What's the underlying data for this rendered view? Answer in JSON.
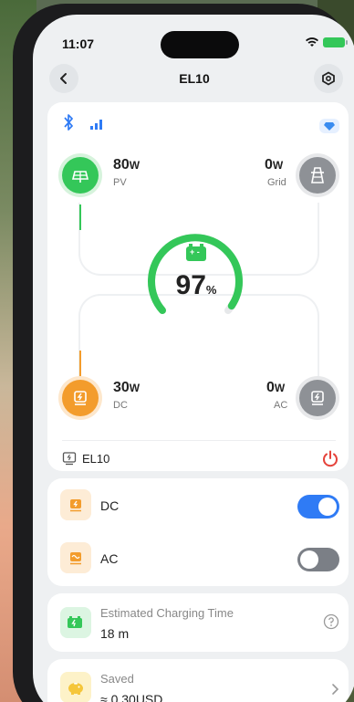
{
  "status": {
    "time": "11:07"
  },
  "nav": {
    "title": "EL10"
  },
  "flow": {
    "pv": {
      "value": "80",
      "unit": "W",
      "label": "PV"
    },
    "grid": {
      "value": "0",
      "unit": "W",
      "label": "Grid"
    },
    "dc": {
      "value": "30",
      "unit": "W",
      "label": "DC"
    },
    "ac": {
      "value": "0",
      "unit": "W",
      "label": "AC"
    },
    "battery": {
      "percent": "97",
      "unit": "%",
      "level": 0.97
    }
  },
  "device": {
    "name": "EL10"
  },
  "outputs": [
    {
      "label": "DC",
      "on": true
    },
    {
      "label": "AC",
      "on": false
    }
  ],
  "charging": {
    "title": "Estimated Charging Time",
    "value": "18 m"
  },
  "saved": {
    "title": "Saved",
    "value": "≈ 0.30USD"
  },
  "colors": {
    "green": "#34c759",
    "orange": "#f39c2c",
    "blue": "#2f7bf5",
    "gray_toggle": "#7b7f86",
    "red": "#e5433b"
  },
  "icons": [
    "back-arrow-icon",
    "settings-hex-icon",
    "bluetooth-icon",
    "signal-bars-icon",
    "premium-diamond-icon",
    "solar-panel-icon",
    "grid-tower-icon",
    "dc-output-icon",
    "ac-output-icon",
    "battery-icon",
    "device-icon",
    "power-icon",
    "help-icon",
    "piggy-bank-icon",
    "chevron-right-icon"
  ]
}
